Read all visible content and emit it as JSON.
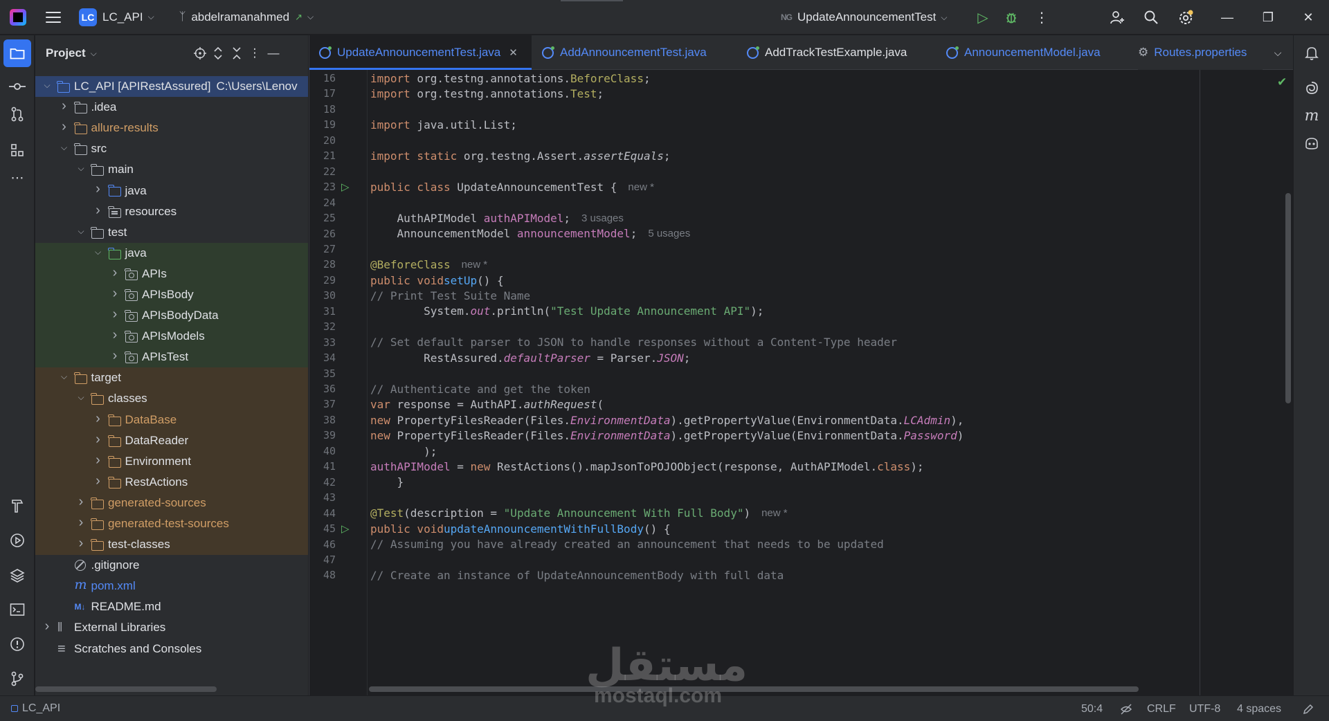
{
  "topbar": {
    "project_badge": "LC",
    "project_name": "LC_API",
    "branch_name": "abdelramanahmed",
    "branch_indicator": "↗",
    "run_config_badge": "NG",
    "run_config_name": "UpdateAnnouncementTest"
  },
  "project_panel": {
    "title": "Project",
    "tree": [
      {
        "label": "LC_API [APIRestAssured]",
        "path": "C:\\Users\\Lenov",
        "level": 0,
        "twisty": "open",
        "icon": "module-folder-icon",
        "style": "sel"
      },
      {
        "label": ".idea",
        "level": 1,
        "twisty": "closed",
        "icon": "folder-icon"
      },
      {
        "label": "allure-results",
        "level": 1,
        "twisty": "closed",
        "icon": "folder-orange-icon",
        "text_color": "orange"
      },
      {
        "label": "src",
        "level": 1,
        "twisty": "open",
        "icon": "folder-icon"
      },
      {
        "label": "main",
        "level": 2,
        "twisty": "open",
        "icon": "folder-icon"
      },
      {
        "label": "java",
        "level": 3,
        "twisty": "closed",
        "icon": "source-folder-icon"
      },
      {
        "label": "resources",
        "level": 3,
        "twisty": "closed",
        "icon": "resources-folder-icon"
      },
      {
        "label": "test",
        "level": 2,
        "twisty": "open",
        "icon": "folder-icon"
      },
      {
        "label": "java",
        "level": 3,
        "twisty": "open",
        "icon": "test-folder-icon",
        "style": "green"
      },
      {
        "label": "APIs",
        "level": 4,
        "twisty": "closed",
        "icon": "package-icon",
        "style": "green"
      },
      {
        "label": "APIsBody",
        "level": 4,
        "twisty": "closed",
        "icon": "package-icon",
        "style": "green"
      },
      {
        "label": "APIsBodyData",
        "level": 4,
        "twisty": "closed",
        "icon": "package-icon",
        "style": "green"
      },
      {
        "label": "APIsModels",
        "level": 4,
        "twisty": "closed",
        "icon": "package-icon",
        "style": "green"
      },
      {
        "label": "APIsTest",
        "level": 4,
        "twisty": "closed",
        "icon": "package-icon",
        "style": "green"
      },
      {
        "label": "target",
        "level": 1,
        "twisty": "open",
        "icon": "folder-orange-icon",
        "style": "orange"
      },
      {
        "label": "classes",
        "level": 2,
        "twisty": "open",
        "icon": "folder-orange-icon",
        "style": "orange"
      },
      {
        "label": "DataBase",
        "level": 3,
        "twisty": "closed",
        "icon": "folder-orange-icon",
        "style": "orange",
        "text_color": "orange"
      },
      {
        "label": "DataReader",
        "level": 3,
        "twisty": "closed",
        "icon": "folder-orange-icon",
        "style": "orange"
      },
      {
        "label": "Environment",
        "level": 3,
        "twisty": "closed",
        "icon": "folder-orange-icon",
        "style": "orange"
      },
      {
        "label": "RestActions",
        "level": 3,
        "twisty": "closed",
        "icon": "folder-orange-icon",
        "style": "orange"
      },
      {
        "label": "generated-sources",
        "level": 2,
        "twisty": "closed",
        "icon": "folder-orange-icon",
        "style": "orange",
        "text_color": "orange"
      },
      {
        "label": "generated-test-sources",
        "level": 2,
        "twisty": "closed",
        "icon": "folder-orange-icon",
        "style": "orange",
        "text_color": "orange"
      },
      {
        "label": "test-classes",
        "level": 2,
        "twisty": "closed",
        "icon": "folder-orange-icon",
        "style": "orange"
      },
      {
        "label": ".gitignore",
        "level": 1,
        "twisty": "none",
        "icon": "gitignore-icon"
      },
      {
        "label": "pom.xml",
        "level": 1,
        "twisty": "none",
        "icon": "maven-icon",
        "text_color": "blue"
      },
      {
        "label": "README.md",
        "level": 1,
        "twisty": "none",
        "icon": "markdown-icon"
      },
      {
        "label": "External Libraries",
        "level": 0,
        "twisty": "closed",
        "icon": "library-icon"
      },
      {
        "label": "Scratches and Consoles",
        "level": 0,
        "twisty": "none",
        "icon": "scratches-icon"
      }
    ]
  },
  "tabs": [
    {
      "label": "UpdateAnnouncementTest.java",
      "active": true,
      "closable": true
    },
    {
      "label": "AddAnnouncementTest.java"
    },
    {
      "label": "AddTrackTestExample.java"
    },
    {
      "label": "AnnouncementModel.java"
    },
    {
      "label": "Routes.properties",
      "gear": true
    }
  ],
  "editor": {
    "lines": [
      {
        "n": "16",
        "html": "<span class=\"kw\">import</span> org.testng.annotations.<span class=\"ann\">BeforeClass</span>;"
      },
      {
        "n": "17",
        "html": "<span class=\"kw\">import</span> org.testng.annotations.<span class=\"ann\">Test</span>;"
      },
      {
        "n": "18",
        "html": ""
      },
      {
        "n": "19",
        "html": "<span class=\"kw\">import</span> java.util.List;"
      },
      {
        "n": "20",
        "html": ""
      },
      {
        "n": "21",
        "html": "<span class=\"kw\">import static</span> org.testng.Assert.<span class=\"ital\">assertEquals</span>;"
      },
      {
        "n": "22",
        "html": ""
      },
      {
        "n": "23",
        "html": "<span class=\"kw\">public class</span> UpdateAnnouncementTest {<span class=\"hint\">new *</span>",
        "run": true
      },
      {
        "n": "24",
        "html": ""
      },
      {
        "n": "25",
        "html": "    AuthAPIModel <span class=\"fld\">authAPIModel</span>;<span class=\"hint\">3 usages</span>"
      },
      {
        "n": "26",
        "html": "    AnnouncementModel <span class=\"fld\">announcementModel</span>;<span class=\"hint\">5 usages</span>"
      },
      {
        "n": "27",
        "html": ""
      },
      {
        "n": "28",
        "html": "    <span class=\"ann\">@BeforeClass</span><span class=\"hint\">new *</span>"
      },
      {
        "n": "29",
        "html": "    <span class=\"kw\">public void</span> <span class=\"fn\">setUp</span>() {"
      },
      {
        "n": "30",
        "html": "        <span class=\"cmt\">// Print Test Suite Name</span>"
      },
      {
        "n": "31",
        "html": "        System.<span class=\"fld ital\">out</span>.println(<span class=\"str\">\"Test Update Announcement API\"</span>);"
      },
      {
        "n": "32",
        "html": ""
      },
      {
        "n": "33",
        "html": "        <span class=\"cmt\">// Set default parser to JSON to handle responses without a Content-Type header</span>"
      },
      {
        "n": "34",
        "html": "        RestAssured.<span class=\"fld ital\">defaultParser</span> = Parser.<span class=\"fld ital\">JSON</span>;"
      },
      {
        "n": "35",
        "html": ""
      },
      {
        "n": "36",
        "html": "        <span class=\"cmt\">// Authenticate and get the token</span>"
      },
      {
        "n": "37",
        "html": "        <span class=\"kw\">var</span> response = AuthAPI.<span class=\"ital\">authRequest</span>("
      },
      {
        "n": "38",
        "html": "                <span class=\"kw\">new</span> PropertyFilesReader(Files.<span class=\"fld ital\">EnvironmentData</span>).getPropertyValue(EnvironmentData.<span class=\"fld ital\">LCAdmin</span>),"
      },
      {
        "n": "39",
        "html": "                <span class=\"kw\">new</span> PropertyFilesReader(Files.<span class=\"fld ital\">EnvironmentData</span>).getPropertyValue(EnvironmentData.<span class=\"fld ital\">Password</span>)"
      },
      {
        "n": "40",
        "html": "        );"
      },
      {
        "n": "41",
        "html": "        <span class=\"fld\">authAPIModel</span> = <span class=\"kw\">new</span> RestActions().mapJsonToPOJOObject(response, AuthAPIModel.<span class=\"kw\">class</span>);"
      },
      {
        "n": "42",
        "html": "    }"
      },
      {
        "n": "43",
        "html": ""
      },
      {
        "n": "44",
        "html": "    <span class=\"ann\">@Test</span>(description = <span class=\"str\">\"Update Announcement With Full Body\"</span>)<span class=\"hint\">new *</span>"
      },
      {
        "n": "45",
        "html": "    <span class=\"kw\">public void</span> <span class=\"fn\">updateAnnouncementWithFullBody</span>() {",
        "run": true
      },
      {
        "n": "46",
        "html": "        <span class=\"cmt\">// Assuming you have already created an announcement that needs to be updated</span>"
      },
      {
        "n": "47",
        "html": ""
      },
      {
        "n": "48",
        "html": "        <span class=\"cmt\">// Create an instance of UpdateAnnouncementBody with full data</span>"
      }
    ]
  },
  "statusbar": {
    "project": "LC_API",
    "position": "50:4",
    "line_separator": "CRLF",
    "encoding": "UTF-8",
    "indent": "4 spaces"
  },
  "watermark": {
    "arabic": "مستقل",
    "latin": "mostaql.com"
  }
}
